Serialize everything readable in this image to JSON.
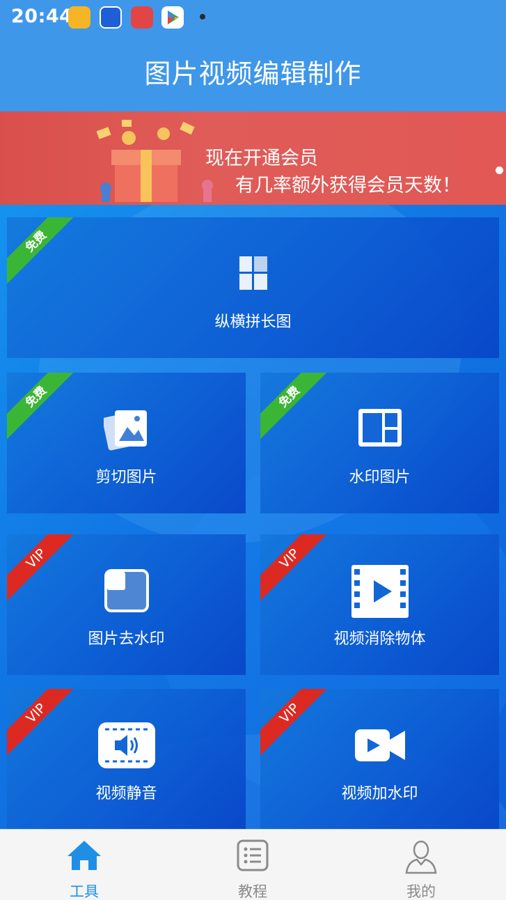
{
  "status_bar": {
    "time": "20:44"
  },
  "header": {
    "title": "图片视频编辑制作"
  },
  "banner": {
    "line1": "现在开通会员",
    "line2": "有几率额外获得会员天数！"
  },
  "tools": [
    {
      "label": "纵横拼长图",
      "badge": "免费",
      "icon": "grid-icon"
    },
    {
      "label": "剪切图片",
      "badge": "免费",
      "icon": "photos-icon"
    },
    {
      "label": "水印图片",
      "badge": "免费",
      "icon": "layout-icon"
    },
    {
      "label": "图片去水印",
      "badge": "VIP",
      "icon": "image-frame-icon"
    },
    {
      "label": "视频消除物体",
      "badge": "VIP",
      "icon": "film-play-icon"
    },
    {
      "label": "视频静音",
      "badge": "VIP",
      "icon": "mute-video-icon"
    },
    {
      "label": "视频加水印",
      "badge": "VIP",
      "icon": "video-camera-icon"
    }
  ],
  "bottom_nav": [
    {
      "label": "工具",
      "icon": "home-icon",
      "active": true
    },
    {
      "label": "教程",
      "icon": "list-icon",
      "active": false
    },
    {
      "label": "我的",
      "icon": "user-icon",
      "active": false
    }
  ],
  "colors": {
    "header": "#3f97ea",
    "free_badge": "#3bb536",
    "vip_badge": "#dc2a22",
    "nav_active": "#1f8fe6"
  }
}
